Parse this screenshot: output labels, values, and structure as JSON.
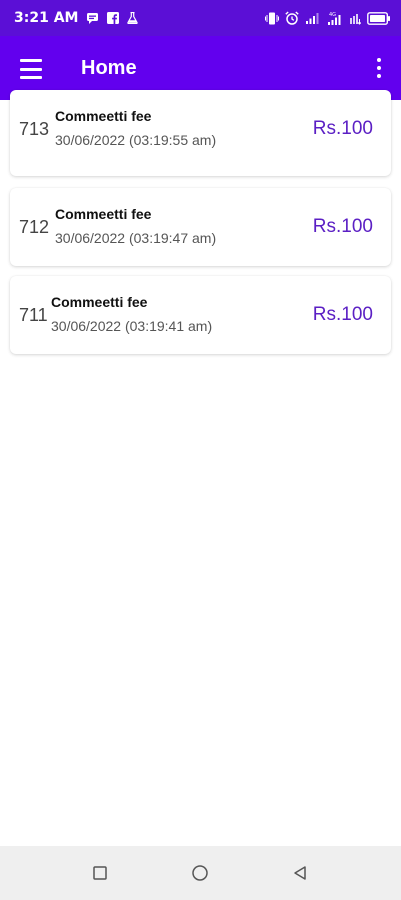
{
  "status_bar": {
    "time": "3:21 AM",
    "left_icons": [
      "message-icon",
      "facebook-icon",
      "flask-icon"
    ],
    "right_icons": [
      "vibrate-icon",
      "alarm-icon",
      "signal-icon",
      "signal-icon",
      "wifi-icon",
      "battery-icon"
    ]
  },
  "app_bar": {
    "title": "Home",
    "menu_icon": "hamburger-menu-icon",
    "overflow_icon": "more-vert-icon"
  },
  "transactions": [
    {
      "id": "713",
      "title": "Commeetti fee",
      "datetime": "30/06/2022 (03:19:55 am)",
      "amount": "Rs.100"
    },
    {
      "id": "712",
      "title": "Commeetti fee",
      "datetime": "30/06/2022 (03:19:47 am)",
      "amount": "Rs.100"
    },
    {
      "id": "711",
      "title": "Commeetti fee",
      "datetime": "30/06/2022 (03:19:41 am)",
      "amount": "Rs.100"
    }
  ],
  "nav_bar": {
    "buttons": [
      "recents-square-icon",
      "home-circle-icon",
      "back-triangle-icon"
    ]
  },
  "colors": {
    "status_bar_bg": "#5b0fd6",
    "app_bar_bg": "#6200ee",
    "amount_text": "#5b1fc4",
    "nav_bar_bg": "#efefef"
  }
}
